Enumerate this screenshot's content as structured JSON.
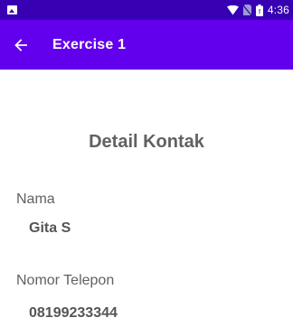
{
  "status_bar": {
    "time": "4:36",
    "icons": [
      "image-notification-icon",
      "wifi-icon",
      "no-sim-icon",
      "battery-icon"
    ]
  },
  "app_bar": {
    "back_icon": "arrow-left-icon",
    "title": "Exercise 1"
  },
  "content": {
    "heading": "Detail Kontak",
    "fields": [
      {
        "label": "Nama",
        "value": "Gita S"
      },
      {
        "label": "Nomor Telepon",
        "value": "08199233344"
      }
    ]
  },
  "colors": {
    "status_bar": "#3700b3",
    "app_bar": "#6200ee",
    "text": "#616161"
  }
}
